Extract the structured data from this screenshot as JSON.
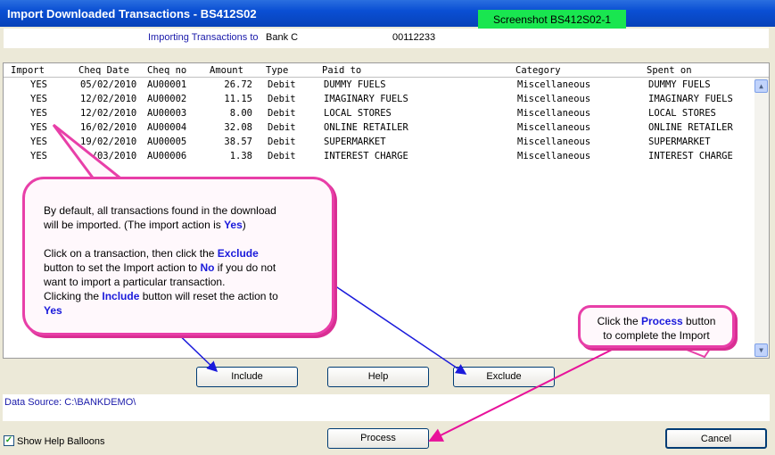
{
  "window": {
    "title": "Import Downloaded Transactions - BS412S02",
    "screenshot_label": "Screenshot BS412S02-1"
  },
  "import_to": {
    "label": "Importing Transactions to",
    "bank": "Bank C",
    "account": "00112233"
  },
  "table": {
    "columns": [
      "Import",
      "Cheq Date",
      "Cheq no",
      "Amount",
      "Type",
      "Paid to",
      "Category",
      "Spent on"
    ],
    "rows": [
      {
        "import": "YES",
        "date": "05/02/2010",
        "cheq": "AU00001",
        "amount": "26.72",
        "type": "Debit",
        "paid_to": "DUMMY FUELS",
        "category": "Miscellaneous",
        "spent_on": "DUMMY FUELS"
      },
      {
        "import": "YES",
        "date": "12/02/2010",
        "cheq": "AU00002",
        "amount": "11.15",
        "type": "Debit",
        "paid_to": "IMAGINARY FUELS",
        "category": "Miscellaneous",
        "spent_on": "IMAGINARY FUELS"
      },
      {
        "import": "YES",
        "date": "12/02/2010",
        "cheq": "AU00003",
        "amount": "8.00",
        "type": "Debit",
        "paid_to": "LOCAL STORES",
        "category": "Miscellaneous",
        "spent_on": "LOCAL STORES"
      },
      {
        "import": "YES",
        "date": "16/02/2010",
        "cheq": "AU00004",
        "amount": "32.08",
        "type": "Debit",
        "paid_to": "ONLINE RETAILER",
        "category": "Miscellaneous",
        "spent_on": "ONLINE RETAILER"
      },
      {
        "import": "YES",
        "date": "19/02/2010",
        "cheq": "AU00005",
        "amount": "38.57",
        "type": "Debit",
        "paid_to": "SUPERMARKET",
        "category": "Miscellaneous",
        "spent_on": "SUPERMARKET"
      },
      {
        "import": "YES",
        "date": "0_/03/2010",
        "cheq": "AU00006",
        "amount": "1.38",
        "type": "Debit",
        "paid_to": "INTEREST CHARGE",
        "category": "Miscellaneous",
        "spent_on": "INTEREST CHARGE"
      }
    ]
  },
  "buttons": {
    "include": "Include",
    "help": "Help",
    "exclude": "Exclude",
    "process": "Process",
    "cancel": "Cancel"
  },
  "data_source": "Data Source: C:\\BANKDEMO\\",
  "show_help_balloons": "Show Help Balloons",
  "balloon_main": {
    "line1": "By default, all transactions found in the download",
    "line2a": "will be imported. (The import action is ",
    "kw_yes": "Yes",
    "line2b": ")",
    "line3a": "Click on a transaction, then click the ",
    "kw_exclude": "Exclude",
    "line4a": "button to set the Import action to ",
    "kw_no": "No",
    "line4b": " if you do not",
    "line5": "want to import a particular transaction.",
    "line6a": "Clicking the ",
    "kw_include": "Include",
    "line6b": " button will reset the action to",
    "kw_yes2": "Yes"
  },
  "balloon_process": {
    "line1a": "Click the ",
    "kw_process": "Process",
    "line1b": " button",
    "line2": "to complete the Import"
  },
  "colors": {
    "titlebar": "#0a4fd4",
    "balloon_border": "#e83fa8",
    "keyword": "#1a1adb",
    "arrow_blue": "#1a1adb",
    "arrow_pink": "#e8119a",
    "screenshot_label_bg": "#19e650"
  },
  "icons": {
    "scroll_up": "chevron-up-icon",
    "scroll_down": "chevron-down-icon",
    "checkbox": "checkmark-icon"
  }
}
